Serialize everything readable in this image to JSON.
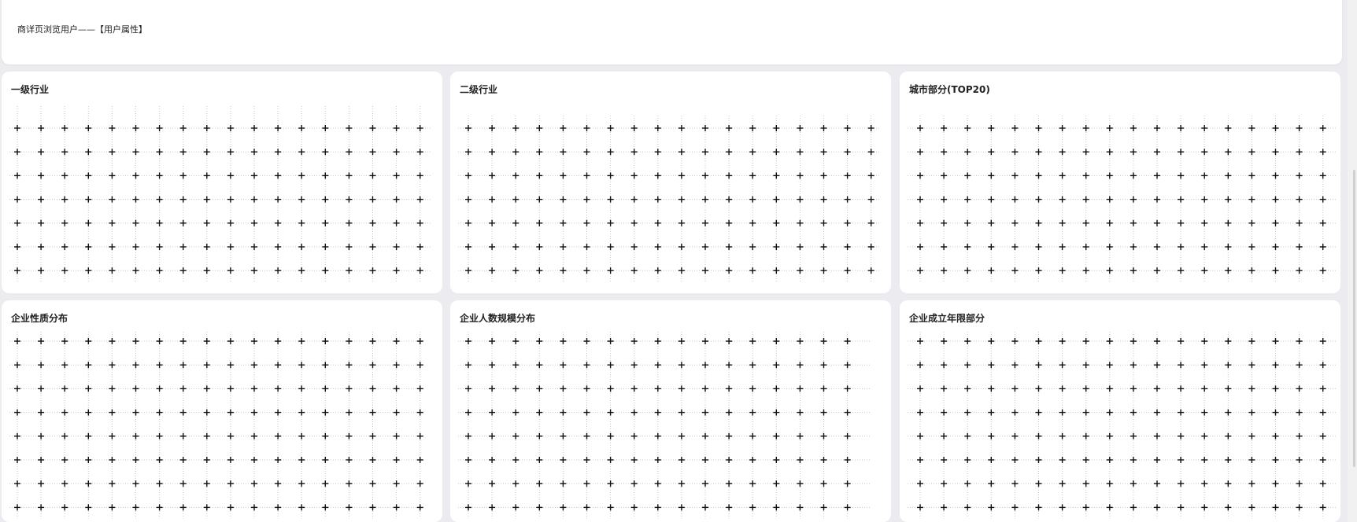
{
  "header": {
    "title": "商详页浏览用户——【用户属性】"
  },
  "cards": [
    {
      "title": "一级行业"
    },
    {
      "title": "二级行业"
    },
    {
      "title": "城市部分(TOP20)"
    },
    {
      "title": "企业性质分布"
    },
    {
      "title": "企业人数规模分布"
    },
    {
      "title": "企业成立年限部分"
    }
  ],
  "grid_pattern": {
    "glyph": "+",
    "color": "#111111",
    "line_color": "#c8c8c8"
  }
}
